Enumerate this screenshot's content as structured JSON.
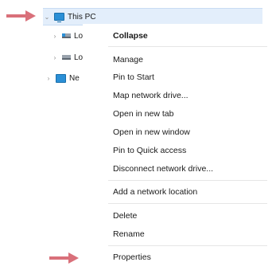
{
  "nav_tree": {
    "items": [
      {
        "label": "This PC",
        "icon": "computer-icon",
        "expanded": true,
        "selected": true
      },
      {
        "label": "Lo",
        "icon": "system-drive-icon",
        "expanded": false
      },
      {
        "label": "Lo",
        "icon": "drive-icon",
        "expanded": false
      },
      {
        "label": "Ne",
        "icon": "network-icon",
        "expanded": false
      }
    ]
  },
  "context_menu": {
    "items": [
      {
        "label": "Collapse",
        "bold": true
      },
      {
        "label": "Manage"
      },
      {
        "label": "Pin to Start"
      },
      {
        "label": "Map network drive..."
      },
      {
        "label": "Open in new tab"
      },
      {
        "label": "Open in new window"
      },
      {
        "label": "Pin to Quick access"
      },
      {
        "label": "Disconnect network drive..."
      },
      {
        "label": "Add a network location"
      },
      {
        "label": "Delete"
      },
      {
        "label": "Rename"
      },
      {
        "label": "Properties"
      }
    ]
  },
  "annotations": {
    "arrow_color": "#d9707a",
    "targets": [
      "This PC",
      "Properties"
    ]
  },
  "colors": {
    "selection_background": "#e3eefb",
    "accent": "#2b8fd6"
  }
}
